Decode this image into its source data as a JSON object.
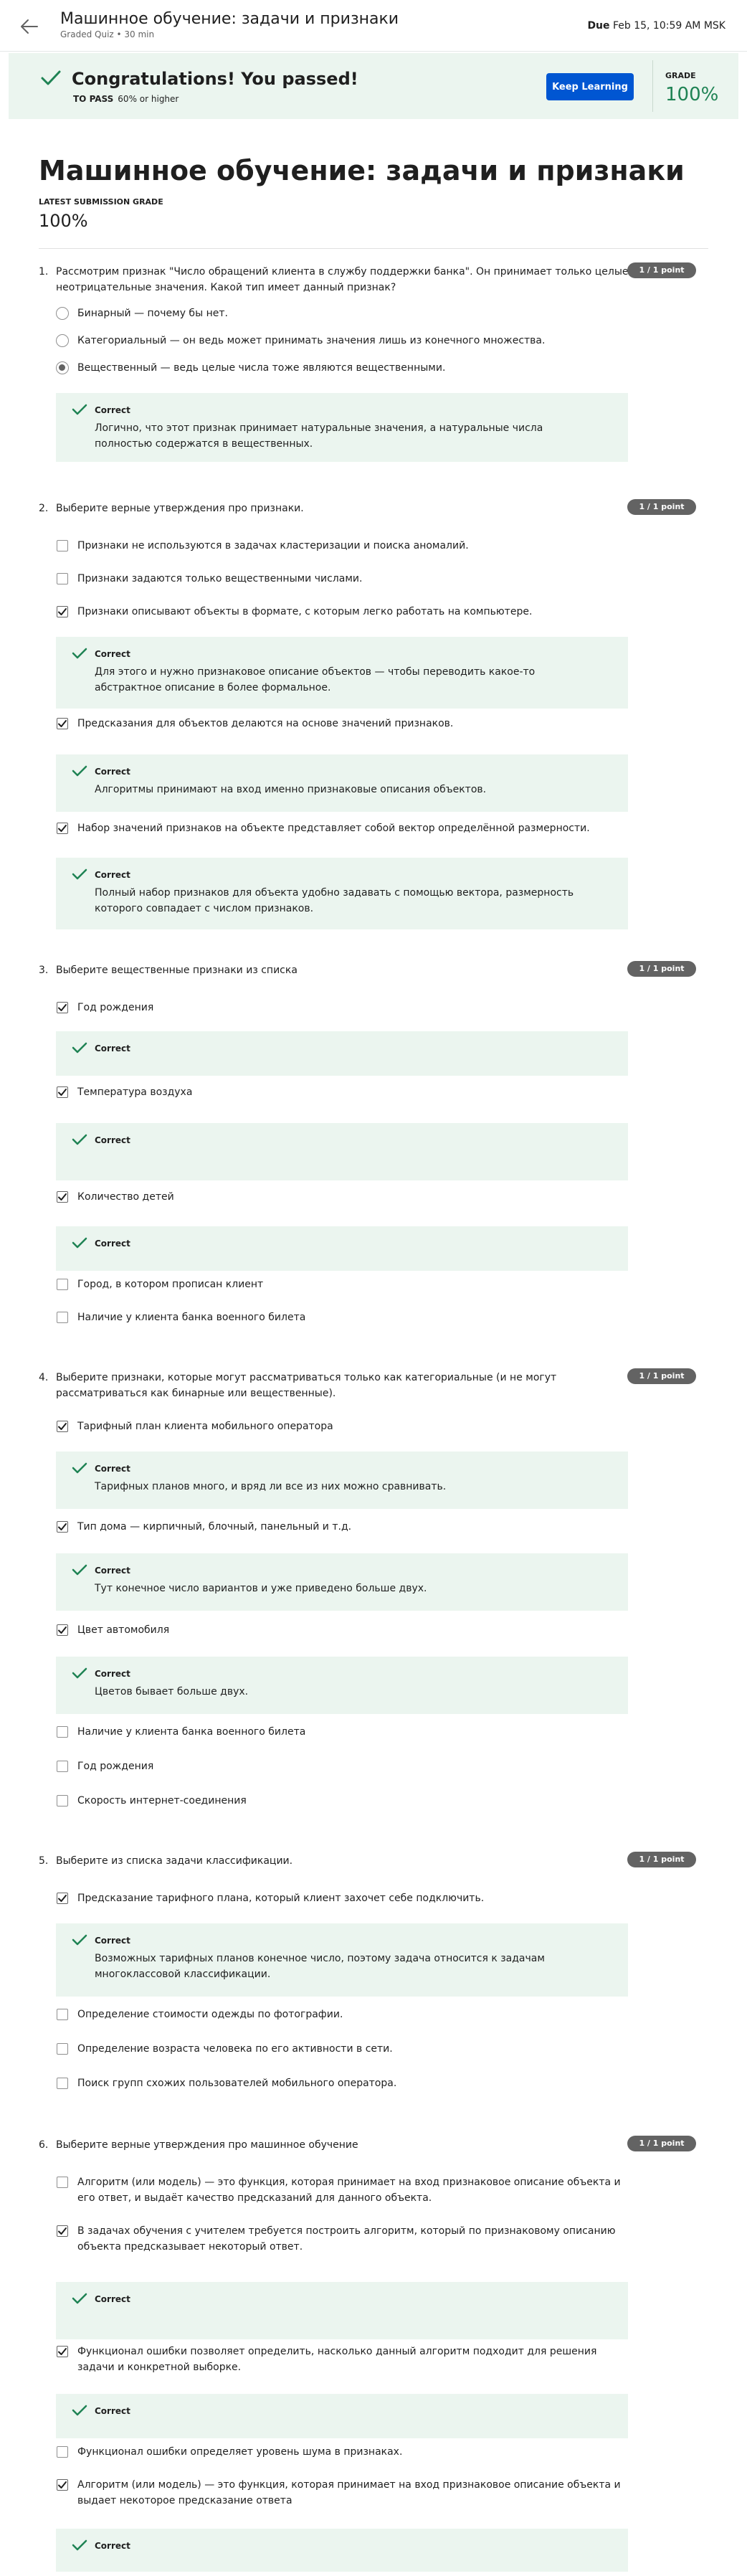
{
  "header": {
    "title": "Машинное обучение: задачи и признаки",
    "subtitle": "Graded Quiz • 30 min",
    "due_label": "Due",
    "due_value": "Feb 15, 10:59 AM MSK"
  },
  "banner": {
    "title": "Congratulations! You passed!",
    "to_pass_label": "TO PASS",
    "to_pass_value": "60% or higher",
    "button": "Keep Learning",
    "grade_label": "GRADE",
    "grade_value": "100%"
  },
  "page": {
    "title": "Машинное обучение: задачи и признаки",
    "latest_label": "LATEST SUBMISSION GRADE",
    "latest_value": "100%"
  },
  "questions": [
    {
      "num": "1.",
      "text": "Рассмотрим признак \"Число обращений клиента в службу поддержки банка\". Он принимает только целые неотрицательные значения. Какой тип имеет данный признак?",
      "points": "1 / 1 point",
      "type": "radio",
      "options": [
        {
          "label": "Бинарный — почему бы нет.",
          "checked": false
        },
        {
          "label": "Категориальный — он ведь может принимать значения лишь из конечного множества.",
          "checked": false
        },
        {
          "label": "Вещественный — ведь целые числа тоже являются вещественными.",
          "checked": true,
          "feedback_title": "Correct",
          "feedback": "Логично, что этот признак принимает натуральные значения, а натуральные числа полностью содержатся в вещественных."
        }
      ]
    },
    {
      "num": "2.",
      "text": "Выберите верные утверждения про признаки.",
      "points": "1 / 1 point",
      "type": "checkbox",
      "options": [
        {
          "label": "Признаки не используются в задачах кластеризации и поиска аномалий.",
          "checked": false
        },
        {
          "label": "Признаки задаются только вещественными числами.",
          "checked": false
        },
        {
          "label": "Признаки описывают объекты в формате, с которым легко работать на компьютере.",
          "checked": true,
          "feedback_title": "Correct",
          "feedback": "Для этого и нужно признаковое описание объектов — чтобы переводить какое-то абстрактное описание в более формальное."
        },
        {
          "label": "Предсказания для объектов делаются на основе значений признаков.",
          "checked": true,
          "feedback_title": "Correct",
          "feedback": "Алгоритмы принимают на вход именно признаковые описания объектов."
        },
        {
          "label": "Набор значений признаков на объекте представляет собой вектор определённой размерности.",
          "checked": true,
          "feedback_title": "Correct",
          "feedback": "Полный набор признаков для объекта удобно задавать с помощью вектора, размерность которого совпадает с числом признаков."
        }
      ]
    },
    {
      "num": "3.",
      "text": "Выберите вещественные признаки из списка",
      "points": "1 / 1 point",
      "type": "checkbox",
      "options": [
        {
          "label": "Год рождения",
          "checked": true,
          "feedback_title": "Correct",
          "feedback": ""
        },
        {
          "label": "Температура воздуха",
          "checked": true,
          "feedback_title": "Correct",
          "feedback": ""
        },
        {
          "label": "Количество детей",
          "checked": true,
          "feedback_title": "Correct",
          "feedback": ""
        },
        {
          "label": "Город, в котором прописан клиент",
          "checked": false
        },
        {
          "label": "Наличие у клиента банка военного билета",
          "checked": false
        }
      ]
    },
    {
      "num": "4.",
      "text": "Выберите признаки, которые могут рассматриваться только как категориальные (и не могут рассматриваться как бинарные или вещественные).",
      "points": "1 / 1 point",
      "type": "checkbox",
      "options": [
        {
          "label": "Тарифный план клиента мобильного оператора",
          "checked": true,
          "feedback_title": "Correct",
          "feedback": "Тарифных планов много, и вряд ли все из них можно сравнивать."
        },
        {
          "label": "Тип дома — кирпичный, блочный, панельный и т.д.",
          "checked": true,
          "feedback_title": "Correct",
          "feedback": "Тут конечное число вариантов и уже приведено больше двух."
        },
        {
          "label": "Цвет автомобиля",
          "checked": true,
          "feedback_title": "Correct",
          "feedback": "Цветов бывает больше двух."
        },
        {
          "label": "Наличие у клиента банка военного билета",
          "checked": false
        },
        {
          "label": "Год рождения",
          "checked": false
        },
        {
          "label": "Скорость интернет-соединения",
          "checked": false
        }
      ]
    },
    {
      "num": "5.",
      "text": "Выберите из списка задачи классификации.",
      "points": "1 / 1 point",
      "type": "checkbox",
      "options": [
        {
          "label": "Предсказание тарифного плана, который клиент захочет себе подключить.",
          "checked": true,
          "feedback_title": "Correct",
          "feedback": "Возможных тарифных планов конечное число, поэтому задача относится к задачам многоклассовой классификации."
        },
        {
          "label": "Определение стоимости одежды по фотографии.",
          "checked": false
        },
        {
          "label": "Определение возраста человека по его активности в сети.",
          "checked": false
        },
        {
          "label": "Поиск групп схожих пользователей мобильного оператора.",
          "checked": false
        }
      ]
    },
    {
      "num": "6.",
      "text": "Выберите верные утверждения про машинное обучение",
      "points": "1 / 1 point",
      "type": "checkbox",
      "options": [
        {
          "label": "Алгоритм (или модель) — это функция, которая принимает на вход признаковое описание объекта и его ответ, и выдаёт качество предсказаний для данного объекта.",
          "checked": false
        },
        {
          "label": "В задачах обучения с учителем требуется построить алгоритм, который по признаковому описанию объекта предсказывает некоторый ответ.",
          "checked": true,
          "feedback_title": "Correct",
          "feedback": ""
        },
        {
          "label": "Функционал ошибки позволяет определить, насколько данный алгоритм подходит для решения задачи и конкретной выборке.",
          "checked": true,
          "feedback_title": "Correct",
          "feedback": ""
        },
        {
          "label": "Функционал ошибки определяет уровень шума в признаках.",
          "checked": false
        },
        {
          "label": "Алгоритм (или модель) — это функция, которая принимает на вход признаковое описание объекта и выдает некоторое предсказание ответа",
          "checked": true,
          "feedback_title": "Correct",
          "feedback": ""
        }
      ]
    }
  ]
}
